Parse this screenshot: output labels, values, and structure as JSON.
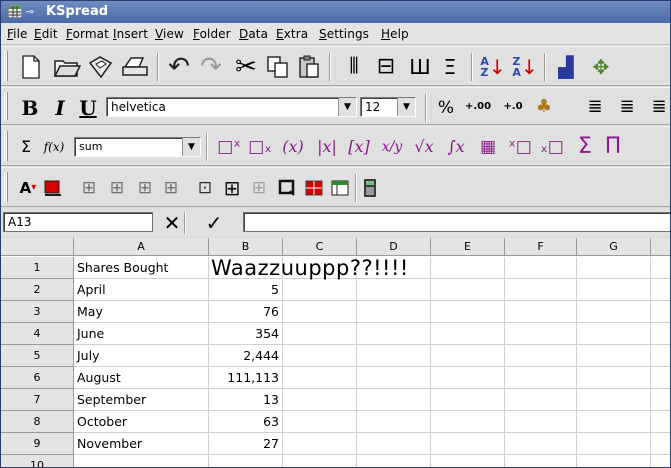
{
  "window": {
    "title": "KSpread"
  },
  "menubar": [
    "File",
    "Edit",
    "Format",
    "Insert",
    "View",
    "Folder",
    "Data",
    "Extra",
    "Settings",
    "Help"
  ],
  "format_toolbar": {
    "bold": "B",
    "italic": "I",
    "underline": "U",
    "font_family": "helvetica",
    "font_size": "12",
    "percent": "%",
    "increase_precision": "+.00",
    "decrease_precision": "+.0"
  },
  "formula_toolbar": {
    "sum_symbol": "Σ",
    "fx_label": "f(x)",
    "function_value": "sum",
    "math_symbols": [
      "□ˣ",
      "□ₓ",
      "(x)",
      "|x|",
      "[x]",
      "x/y",
      "√x",
      "∫x",
      "▦",
      "ˣ□",
      "ₓ□",
      "Σ",
      "Π"
    ]
  },
  "formulabar": {
    "cell_reference": "A13",
    "cancel": "✕",
    "accept": "✓",
    "formula": ""
  },
  "sheet": {
    "columns": [
      "A",
      "B",
      "C",
      "D",
      "E",
      "F",
      "G"
    ],
    "rows": [
      {
        "num": "1",
        "a": "Shares Bought",
        "b": "Waazzuuppp??!!!!"
      },
      {
        "num": "2",
        "a": "April",
        "b": "5"
      },
      {
        "num": "3",
        "a": "May",
        "b": "76"
      },
      {
        "num": "4",
        "a": "June",
        "b": "354"
      },
      {
        "num": "5",
        "a": "July",
        "b": "2,444"
      },
      {
        "num": "6",
        "a": "August",
        "b": "111,113"
      },
      {
        "num": "7",
        "a": "September",
        "b": "13"
      },
      {
        "num": "8",
        "a": "October",
        "b": "63"
      },
      {
        "num": "9",
        "a": "November",
        "b": "27"
      },
      {
        "num": "10",
        "a": "",
        "b": ""
      }
    ]
  },
  "colors": {
    "titlebar": "#4a6aa8",
    "red_swatch": "#d40000",
    "purple_math": "#8a1a8a",
    "green_icon": "#2a7a2a"
  }
}
